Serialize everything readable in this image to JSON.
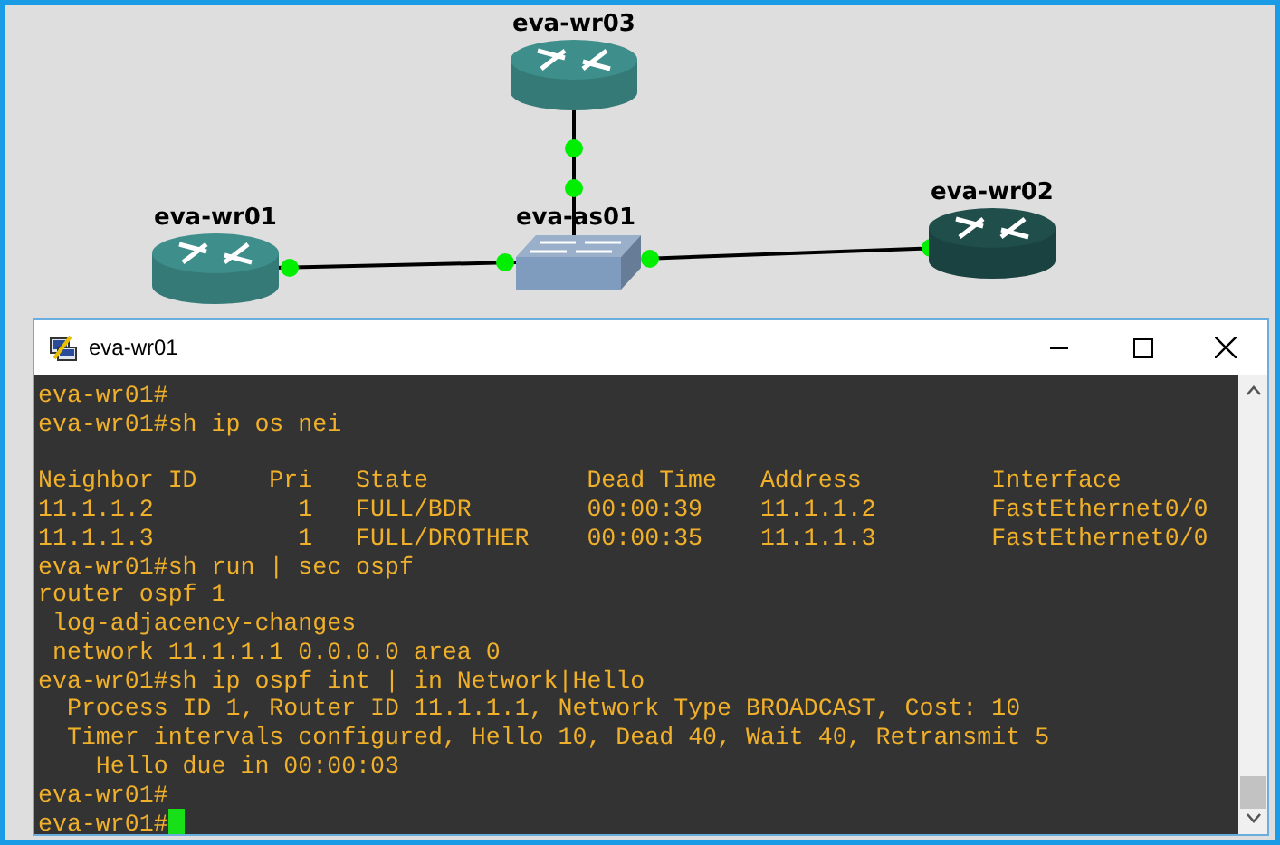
{
  "topology": {
    "nodes": [
      {
        "label": "eva-wr03",
        "kind": "router",
        "color": "#3e8f8c"
      },
      {
        "label": "eva-wr01",
        "kind": "router",
        "color": "#3e8f8c"
      },
      {
        "label": "eva-as01",
        "kind": "switch",
        "color": "#7f9bbd"
      },
      {
        "label": "eva-wr02",
        "kind": "router",
        "color": "#1f4e4b"
      }
    ],
    "links": [
      {
        "connected": true
      },
      {
        "connected": true
      },
      {
        "connected": true
      }
    ]
  },
  "console_window": {
    "title": "eva-wr01",
    "lines_before": [
      "eva-wr01#",
      "eva-wr01#sh ip os nei"
    ],
    "neighbor_table": {
      "columns": [
        "Neighbor ID",
        "Pri",
        "State",
        "Dead Time",
        "Address",
        "Interface"
      ],
      "rows": [
        [
          "11.1.1.2",
          "1",
          "FULL/BDR",
          "00:00:39",
          "11.1.1.2",
          "FastEthernet0/0"
        ],
        [
          "11.1.1.3",
          "1",
          "FULL/DROTHER",
          "00:00:35",
          "11.1.1.3",
          "FastEthernet0/0"
        ]
      ]
    },
    "lines_after": [
      "eva-wr01#sh run | sec ospf",
      "router ospf 1",
      " log-adjacency-changes",
      " network 11.1.1.1 0.0.0.0 area 0",
      "eva-wr01#sh ip ospf int | in Network|Hello",
      "  Process ID 1, Router ID 11.1.1.1, Network Type BROADCAST, Cost: 10",
      "  Timer intervals configured, Hello 10, Dead 40, Wait 40, Retransmit 5",
      "    Hello due in 00:00:03",
      "eva-wr01#",
      "eva-wr01#"
    ]
  }
}
